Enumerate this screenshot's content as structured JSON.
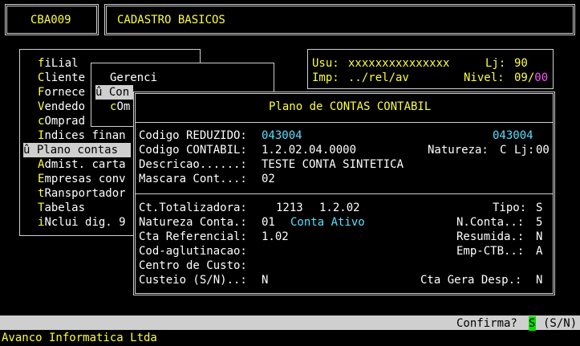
{
  "header": {
    "program_code": "CBA009",
    "program_title": "CADASTRO BASICOS"
  },
  "session": {
    "user_label": "Usu:",
    "user_value": "xxxxxxxxxxxxxxx",
    "store_label": "Lj:",
    "store_value": "90",
    "printer_label": "Imp:",
    "printer_value": "../rel/av",
    "level_label": "Nivel:",
    "level_value": "09",
    "level_sep": "/",
    "level_max": "00"
  },
  "main_menu": {
    "items": [
      {
        "hotkey": "f",
        "rest": "iLial"
      },
      {
        "hotkey": "C",
        "rest": "liente"
      },
      {
        "hotkey": "F",
        "rest": "ornece"
      },
      {
        "hotkey": "V",
        "rest": "endedo"
      },
      {
        "hotkey": "c",
        "rest": "Omprad"
      },
      {
        "hotkey": "I",
        "rest": "ndices finan"
      },
      {
        "hotkey": "",
        "rest": "û Plano contas"
      },
      {
        "hotkey": "A",
        "rest": "dmist. carta"
      },
      {
        "hotkey": "E",
        "rest": "mpresas conv"
      },
      {
        "hotkey": "t",
        "rest": "Ransportador"
      },
      {
        "hotkey": "T",
        "rest": "abelas"
      },
      {
        "hotkey": "i",
        "rest": "Nclui dig. 9"
      }
    ]
  },
  "sub_menu": {
    "header": "Gerenci",
    "items": [
      {
        "hotkey": "",
        "rest": "û Con"
      },
      {
        "hotkey": "c",
        "rest": "Om"
      }
    ]
  },
  "dialog": {
    "title": "Plano de CONTAS CONTABIL",
    "reduzido_label": "Codigo REDUZIDO:",
    "reduzido_value": "043004",
    "reduzido_value_right": "043004",
    "contabil_label": "Codigo CONTABIL:",
    "contabil_value": "1.2.02.04.0000",
    "natureza_label": "Natureza:",
    "natureza_value": "C",
    "lj_label": "Lj:",
    "lj_value": "00",
    "descricao_label": "Descricao......:",
    "descricao_value": "TESTE CONTA SINTETICA",
    "mascara_label": "Mascara Cont...:",
    "mascara_value": "02",
    "totalizadora_label": "Ct.Totalizadora:",
    "totalizadora_value1": "1213",
    "totalizadora_value2": "1.2.02",
    "tipo_label": "Tipo:",
    "tipo_value": "S",
    "natconta_label": "Natureza Conta.:",
    "natconta_value": "01",
    "natconta_desc": "Conta Ativo",
    "nconta_label": "N.Conta..:",
    "nconta_value": "5",
    "ctaref_label": "Cta Referencial:",
    "ctaref_value": "1.02",
    "resumida_label": "Resumida.:",
    "resumida_value": "N",
    "codaglut_label": "Cod-aglutinacao:",
    "empctb_label": "Emp-CTB..:",
    "empctb_value": "A",
    "centro_label": "Centro de Custo:",
    "custeio_label": "Custeio (S/N)..:",
    "custeio_value": "N",
    "geradesp_label": "Cta Gera Desp.:",
    "geradesp_value": "N"
  },
  "prompt": {
    "label": "Confirma?",
    "value": "S",
    "options": "(S/N)"
  },
  "footer": {
    "company": "Avanco Informatica Ltda"
  }
}
